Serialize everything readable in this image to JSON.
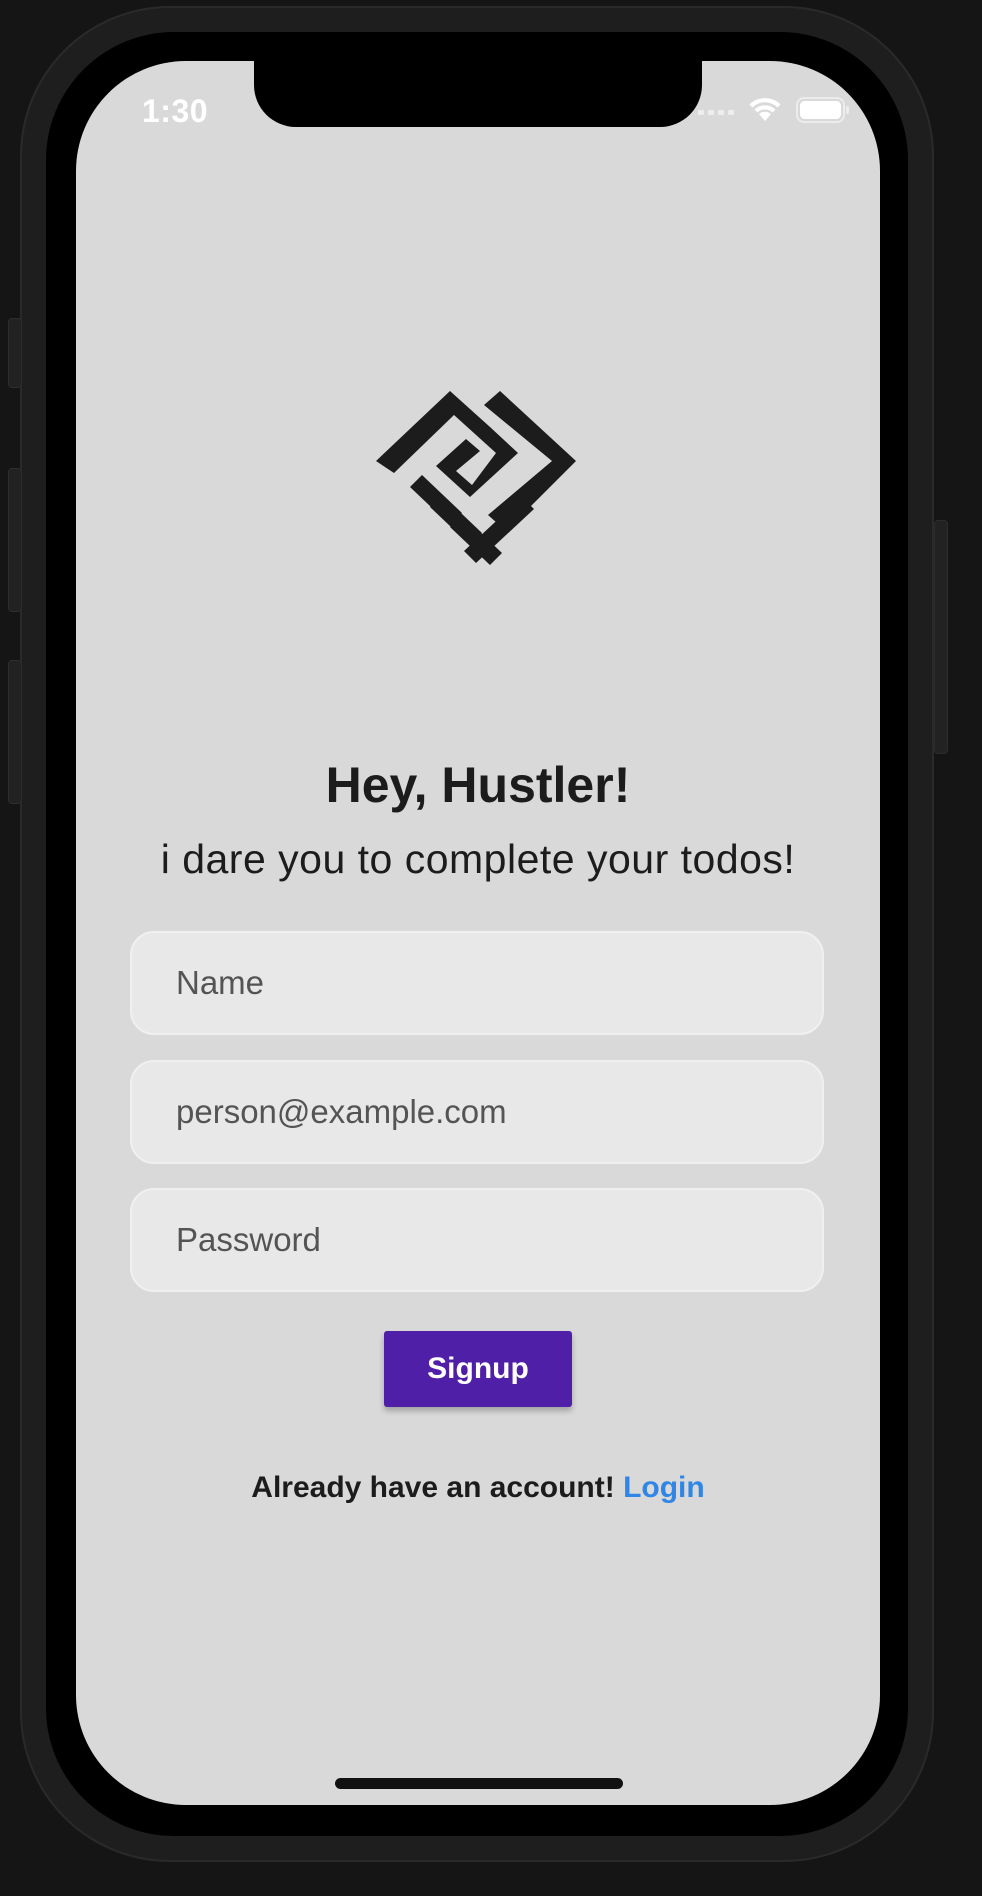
{
  "status_bar": {
    "time": "1:30"
  },
  "logo": {
    "icon": "handshake-diamond-logo",
    "color": "#1c1c1c"
  },
  "header": {
    "title": "Hey, Hustler!",
    "subtitle": "i dare you to complete your todos!"
  },
  "form": {
    "name_placeholder": "Name",
    "name_value": "",
    "email_placeholder": "person@example.com",
    "email_value": "",
    "password_placeholder": "Password",
    "password_value": ""
  },
  "signup_button": {
    "label": "Signup",
    "color": "#4f1fa8"
  },
  "footer": {
    "prompt": "Already have an account! ",
    "login_label": "Login",
    "link_color": "#2f86e6"
  }
}
